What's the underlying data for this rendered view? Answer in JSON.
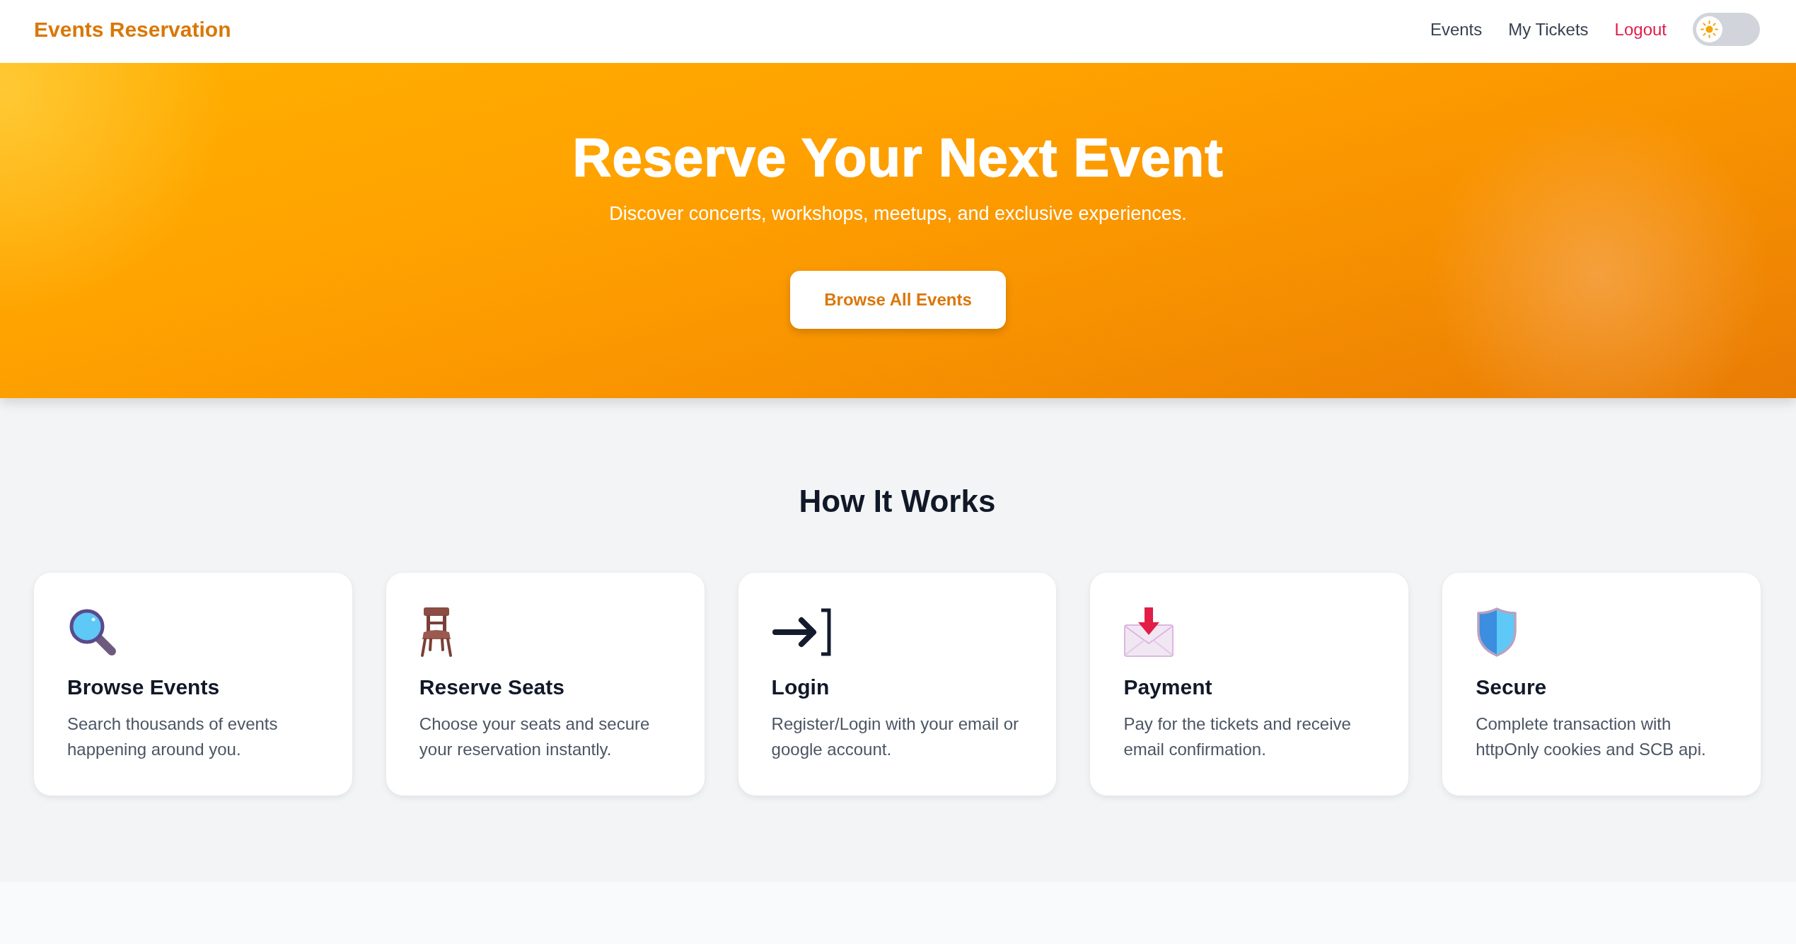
{
  "header": {
    "brand": "Events Reservation",
    "nav": [
      {
        "label": "Events",
        "kind": "link"
      },
      {
        "label": "My Tickets",
        "kind": "link"
      },
      {
        "label": "Logout",
        "kind": "logout"
      }
    ],
    "theme_toggle": {
      "on": false
    }
  },
  "hero": {
    "title": "Reserve Your Next Event",
    "subtitle": "Discover concerts, workshops, meetups, and exclusive experiences.",
    "button": "Browse All Events"
  },
  "how_it_works": {
    "title": "How It Works",
    "steps": [
      {
        "title": "Browse Events",
        "text": "Search thousands of events happening around you."
      },
      {
        "title": "Reserve Seats",
        "text": "Choose your seats and secure your reservation instantly."
      },
      {
        "title": "Login",
        "text": "Register/Login with your email or google account."
      },
      {
        "title": "Payment",
        "text": "Pay for the tickets and receive email confirmation."
      },
      {
        "title": "Secure",
        "text": "Complete transaction with httpOnly cookies and SCB api."
      }
    ]
  }
}
